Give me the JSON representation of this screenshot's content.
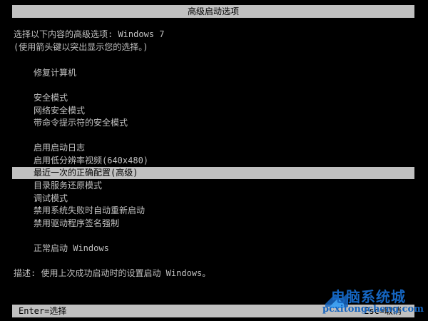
{
  "title": "高级启动选项",
  "intro": {
    "line1": "选择以下内容的高级选项: Windows 7",
    "line2": "(使用箭头键以突出显示您的选择。)"
  },
  "options": [
    "修复计算机",
    "安全模式",
    "网络安全模式",
    "带命令提示符的安全模式",
    "启用启动日志",
    "启用低分辨率视频(640x480)",
    "最近一次的正确配置(高级)",
    "目录服务还原模式",
    "调试模式",
    "禁用系统失败时自动重新启动",
    "禁用驱动程序签名强制",
    "正常启动 Windows"
  ],
  "selected_index": 6,
  "description": "描述: 使用上次成功启动时的设置启动 Windows。",
  "footer": {
    "left": "Enter=选择",
    "right": "Esc=取消"
  },
  "watermark": {
    "text": "电脑系统城",
    "url": "pcxitongcheng.com"
  },
  "colors": {
    "background": "#000000",
    "text": "#c0c0c0",
    "highlight_bg": "#c0c0c0",
    "highlight_text": "#000000",
    "watermark": "#1565c0"
  }
}
